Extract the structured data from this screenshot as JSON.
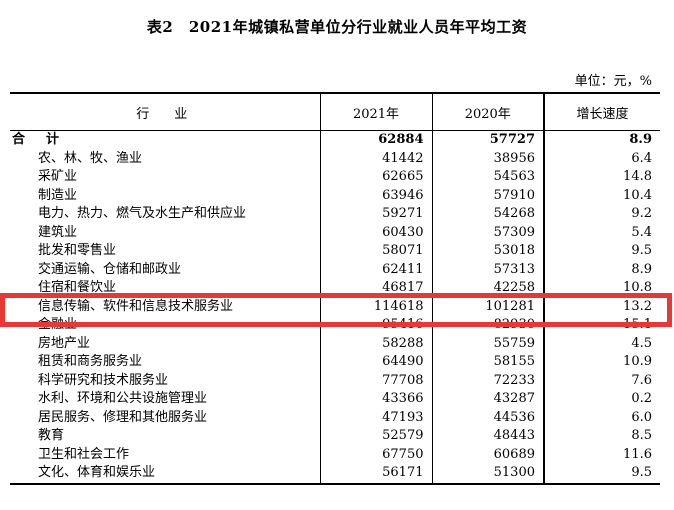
{
  "title": "表2　2021年城镇私营单位分行业就业人员年平均工资",
  "unit": "单位：元，%",
  "headers": {
    "industry": "行　业",
    "y2021": "2021年",
    "y2020": "2020年",
    "growth": "增长速度"
  },
  "rows": [
    {
      "label": "合　计",
      "v2021": "62884",
      "v2020": "57727",
      "growth": "8.9"
    },
    {
      "label": "农、林、牧、渔业",
      "v2021": "41442",
      "v2020": "38956",
      "growth": "6.4"
    },
    {
      "label": "采矿业",
      "v2021": "62665",
      "v2020": "54563",
      "growth": "14.8"
    },
    {
      "label": "制造业",
      "v2021": "63946",
      "v2020": "57910",
      "growth": "10.4"
    },
    {
      "label": "电力、热力、燃气及水生产和供应业",
      "v2021": "59271",
      "v2020": "54268",
      "growth": "9.2"
    },
    {
      "label": "建筑业",
      "v2021": "60430",
      "v2020": "57309",
      "growth": "5.4"
    },
    {
      "label": "批发和零售业",
      "v2021": "58071",
      "v2020": "53018",
      "growth": "9.5"
    },
    {
      "label": "交通运输、仓储和邮政业",
      "v2021": "62411",
      "v2020": "57313",
      "growth": "8.9"
    },
    {
      "label": "住宿和餐饮业",
      "v2021": "46817",
      "v2020": "42258",
      "growth": "10.8"
    },
    {
      "label": "信息传输、软件和信息技术服务业",
      "v2021": "114618",
      "v2020": "101281",
      "growth": "13.2"
    },
    {
      "label": "金融业",
      "v2021": "95416",
      "v2020": "82930",
      "growth": "15.1"
    },
    {
      "label": "房地产业",
      "v2021": "58288",
      "v2020": "55759",
      "growth": "4.5"
    },
    {
      "label": "租赁和商务服务业",
      "v2021": "64490",
      "v2020": "58155",
      "growth": "10.9"
    },
    {
      "label": "科学研究和技术服务业",
      "v2021": "77708",
      "v2020": "72233",
      "growth": "7.6"
    },
    {
      "label": "水利、环境和公共设施管理业",
      "v2021": "43366",
      "v2020": "43287",
      "growth": "0.2"
    },
    {
      "label": "居民服务、修理和其他服务业",
      "v2021": "47193",
      "v2020": "44536",
      "growth": "6.0"
    },
    {
      "label": "教育",
      "v2021": "52579",
      "v2020": "48443",
      "growth": "8.5"
    },
    {
      "label": "卫生和社会工作",
      "v2021": "67750",
      "v2020": "60689",
      "growth": "11.6"
    },
    {
      "label": "文化、体育和娱乐业",
      "v2021": "56171",
      "v2020": "51300",
      "growth": "9.5"
    }
  ],
  "colors": {
    "highlight_border": "#e53935"
  }
}
